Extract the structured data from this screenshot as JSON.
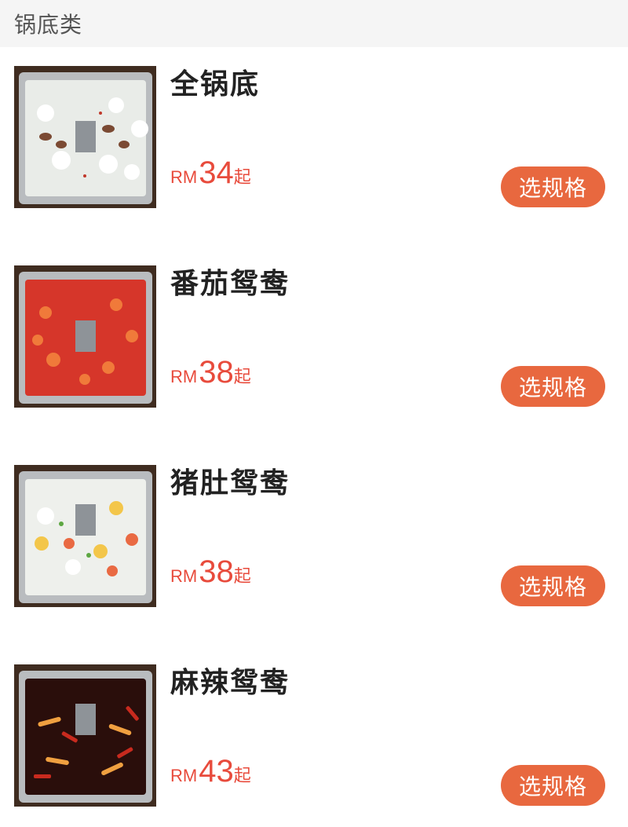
{
  "category": {
    "title": "锅底类"
  },
  "items": [
    {
      "name": "全锅底",
      "currency": "RM",
      "price": "34",
      "suffix": "起",
      "button_label": "选规格",
      "image_icon": "clear-broth-hotpot-image"
    },
    {
      "name": "番茄鸳鸯",
      "currency": "RM",
      "price": "38",
      "suffix": "起",
      "button_label": "选规格",
      "image_icon": "tomato-hotpot-image"
    },
    {
      "name": "猪肚鸳鸯",
      "currency": "RM",
      "price": "38",
      "suffix": "起",
      "button_label": "选规格",
      "image_icon": "pork-tripe-hotpot-image"
    },
    {
      "name": "麻辣鸳鸯",
      "currency": "RM",
      "price": "43",
      "suffix": "起",
      "button_label": "选规格",
      "image_icon": "spicy-hotpot-image"
    }
  ],
  "colors": {
    "price": "#e84b3c",
    "button": "#e8683f",
    "header_bg": "#f5f5f5"
  }
}
